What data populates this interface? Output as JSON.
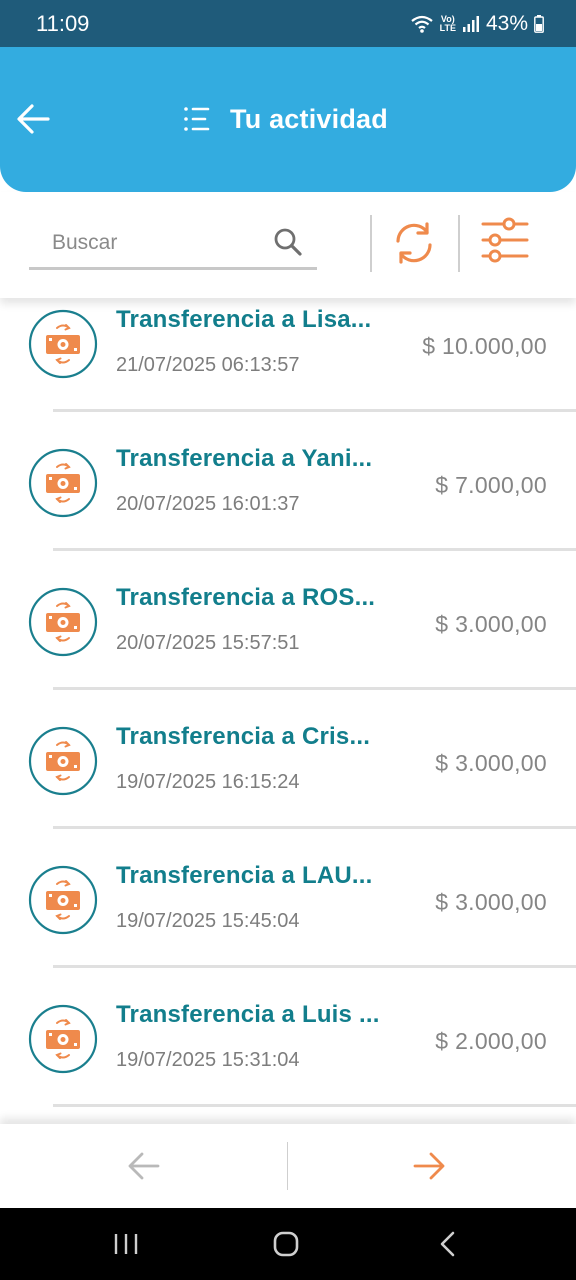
{
  "status_bar": {
    "time": "11:09",
    "lte_top": "Vo)",
    "lte_bottom": "LTE",
    "battery": "43%"
  },
  "header": {
    "title": "Tu actividad",
    "back_icon": "arrow-left-icon",
    "title_icon": "list-icon"
  },
  "search": {
    "placeholder": "Buscar",
    "value": "",
    "search_icon": "search-icon",
    "refresh_icon": "refresh-icon",
    "filter_icon": "sliders-icon"
  },
  "transactions": [
    {
      "title": "Transferencia a Lisa...",
      "date": "21/07/2025 06:13:57",
      "amount": "$ 10.000,00"
    },
    {
      "title": "Transferencia a Yani...",
      "date": "20/07/2025 16:01:37",
      "amount": "$ 7.000,00"
    },
    {
      "title": "Transferencia a ROS...",
      "date": "20/07/2025 15:57:51",
      "amount": "$ 3.000,00"
    },
    {
      "title": "Transferencia a Cris...",
      "date": "19/07/2025 16:15:24",
      "amount": "$ 3.000,00"
    },
    {
      "title": "Transferencia a LAU...",
      "date": "19/07/2025 15:45:04",
      "amount": "$ 3.000,00"
    },
    {
      "title": "Transferencia a Luis ...",
      "date": "19/07/2025 15:31:04",
      "amount": "$ 2.000,00"
    }
  ],
  "pager": {
    "prev_icon": "arrow-left-icon",
    "next_icon": "arrow-right-icon"
  },
  "colors": {
    "header_bg": "#33ace0",
    "status_bg": "#1f5b7a",
    "accent_orange": "#ef8a4c",
    "title_teal": "#127e8c",
    "icon_ring": "#1a7f8e"
  }
}
